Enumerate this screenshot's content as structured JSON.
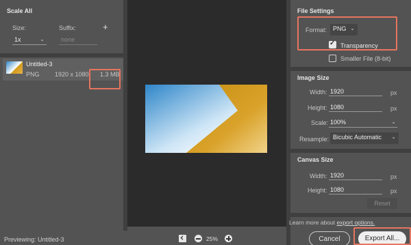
{
  "scale_all": {
    "title": "Scale All",
    "size_label": "Size:",
    "suffix_label": "Suffix:",
    "add_symbol": "+",
    "size_value": "1x",
    "suffix_placeholder": "none"
  },
  "asset": {
    "name": "Untitled-3",
    "format": "PNG",
    "dimensions": "1920 x 1080",
    "filesize": "1.3 MB"
  },
  "file_settings": {
    "title": "File Settings",
    "format_label": "Format:",
    "format_value": "PNG",
    "transparency_label": "Transparency",
    "transparency_checked": true,
    "smaller_file_label": "Smaller File (8-bit)",
    "smaller_file_checked": false
  },
  "image_size": {
    "title": "Image Size",
    "width_label": "Width:",
    "width_value": "1920",
    "height_label": "Height:",
    "height_value": "1080",
    "scale_label": "Scale:",
    "scale_value": "100%",
    "resample_label": "Resample:",
    "resample_value": "Bicubic Automatic",
    "unit": "px"
  },
  "canvas_size": {
    "title": "Canvas Size",
    "width_label": "Width:",
    "width_value": "1920",
    "height_label": "Height:",
    "height_value": "1080",
    "unit": "px",
    "reset_label": "Reset"
  },
  "footer": {
    "previewing_text": "Previewing: Untitled-3",
    "zoom_value": "25%",
    "learn_more_prefix": "Learn more about ",
    "learn_more_link": "export options.",
    "cancel_label": "Cancel",
    "export_label": "Export All..."
  },
  "colors": {
    "highlight": "#e8755f",
    "panel": "#535353",
    "preview_bg": "#2b2b2b",
    "image_blue": "#2f86c9",
    "image_gold": "#d39a1a"
  }
}
